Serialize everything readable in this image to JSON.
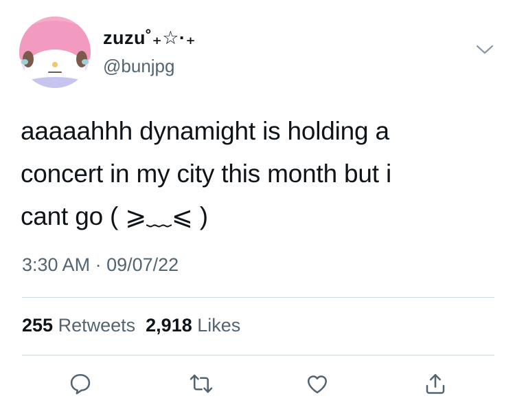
{
  "user": {
    "display_name": "zuzu˚₊☆·₊",
    "handle": "@bunjpg"
  },
  "tweet": {
    "text_lines": [
      "aaaaahhh dynamight is holding a",
      "concert in my city this month but i",
      "cant go ( ⩾﹏⩽ )"
    ],
    "time": "3:30 AM",
    "separator": "·",
    "date": "09/07/22"
  },
  "stats": {
    "retweets_count": "255",
    "retweets_label": "Retweets",
    "likes_count": "2,918",
    "likes_label": "Likes"
  },
  "icons": {
    "menu": "chevron-down-icon",
    "reply": "reply-icon",
    "retweet": "retweet-icon",
    "like": "heart-icon",
    "share": "share-icon"
  },
  "colors": {
    "text_primary": "#0f1419",
    "text_secondary": "#536471",
    "divider": "#cfd9de"
  }
}
